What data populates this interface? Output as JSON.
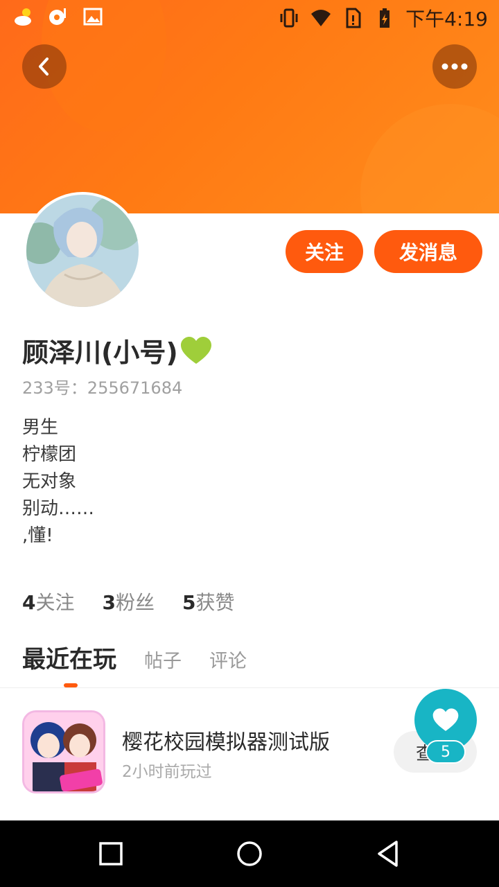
{
  "status_bar": {
    "time": "下午4:19",
    "left_icons": [
      "weather-icon",
      "music-icon",
      "image-icon"
    ],
    "right_icons": [
      "vibrate-icon",
      "wifi-icon",
      "sim-icon",
      "battery-icon"
    ]
  },
  "header": {
    "back_icon": "chevron-left-icon",
    "more_icon": "more-dots-icon",
    "gradient_color": "#ff7a14"
  },
  "actions": {
    "follow_label": "关注",
    "message_label": "发消息",
    "accent_color": "#ff5a0e"
  },
  "profile": {
    "name": "顾泽川(小号)",
    "badge_icon": "green-heart-icon",
    "id_text": "233号：255671684",
    "bio_lines": [
      "男生",
      "柠檬团",
      "无对象",
      "别动……",
      ",懂!"
    ]
  },
  "stats": {
    "following_count": "4",
    "following_label": "关注",
    "fans_count": "3",
    "fans_label": "粉丝",
    "likes_count": "5",
    "likes_label": "获赞"
  },
  "tabs": {
    "items": [
      "最近在玩",
      "帖子",
      "评论"
    ],
    "active": "最近在玩"
  },
  "recent_game": {
    "title": "樱花校园模拟器测试版",
    "subtitle": "2小时前玩过",
    "button_label": "查",
    "like_count": "5"
  },
  "nav_bar": {
    "icons": [
      "recent-apps-icon",
      "home-icon",
      "back-icon"
    ]
  }
}
